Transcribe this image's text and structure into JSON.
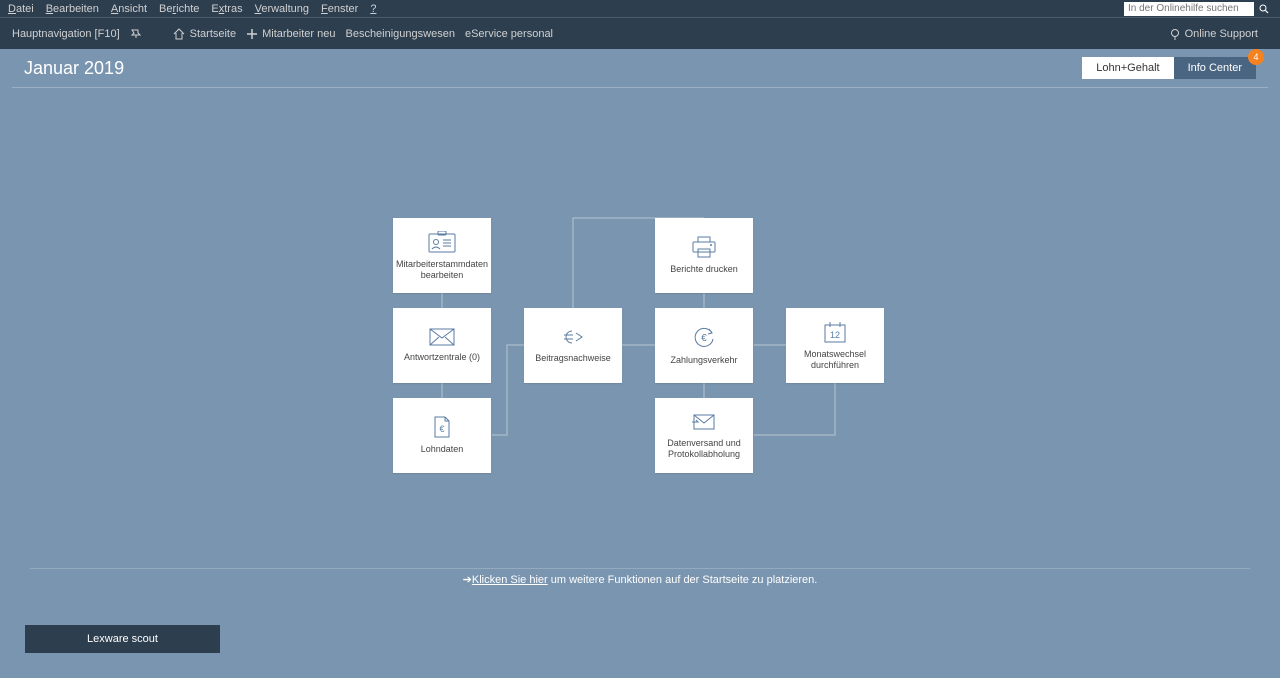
{
  "menubar": {
    "items": [
      "Datei",
      "Bearbeiten",
      "Ansicht",
      "Berichte",
      "Extras",
      "Verwaltung",
      "Fenster",
      "?"
    ],
    "search_placeholder": "In der Onlinehilfe suchen"
  },
  "toolbar": {
    "hauptnav": "Hauptnavigation [F10]",
    "startseite": "Startseite",
    "mitarbeiter_neu": "Mitarbeiter neu",
    "bescheinigung": "Bescheinigungswesen",
    "eservice": "eService personal",
    "online_support": "Online Support"
  },
  "header": {
    "title": "Januar 2019",
    "tab_active": "Lohn+Gehalt",
    "tab_info": "Info Center",
    "badge": "4"
  },
  "tiles": {
    "t1": "Mitarbeiterstammdaten bearbeiten",
    "t2": "Berichte drucken",
    "t3": "Antwortzentrale (0)",
    "t4": "Beitragsnachweise",
    "t5": "Zahlungsverkehr",
    "t6": "Monatswechsel durchführen",
    "t7": "Lohndaten",
    "t8": "Datenversand und Protokollabholung"
  },
  "footer": {
    "link": "Klicken Sie hier",
    "rest": " um weitere Funktionen auf der Startseite zu platzieren."
  },
  "scout": "Lexware scout"
}
